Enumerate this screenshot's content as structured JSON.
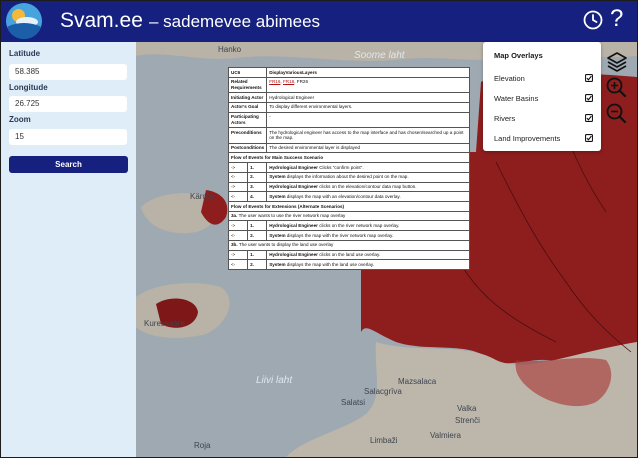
{
  "header": {
    "app_name": "Svam.ee",
    "subtitle": "– sademevee abimees",
    "help_symbol": "?"
  },
  "sidebar": {
    "latitude_label": "Latitude",
    "latitude_value": "58.385",
    "longitude_label": "Longitude",
    "longitude_value": "26.725",
    "zoom_label": "Zoom",
    "zoom_value": "15",
    "search_label": "Search"
  },
  "overlays": {
    "title": "Map Overlays",
    "items": [
      {
        "label": "Elevation",
        "checked": true
      },
      {
        "label": "Water Basins",
        "checked": true
      },
      {
        "label": "Rivers",
        "checked": true
      },
      {
        "label": "Land Improvements",
        "checked": true
      }
    ]
  },
  "map_labels": {
    "hanko": "Hanko",
    "soome_laht": "Soome laht",
    "kardla": "Kärdla",
    "kuressaare": "Kuressaare",
    "liivi_laht": "Liivi laht",
    "mazsalaca": "Mazsalaca",
    "salacgriva": "Salacgrīva",
    "salatsi": "Salatsi",
    "valka": "Valka",
    "strenci": "Strenči",
    "valmiera": "Valmiera",
    "limbazi": "Limbaži",
    "roja": "Roja"
  },
  "doc": {
    "uc_label": "UC6",
    "uc_value": "DisplayVariousLayers",
    "req_label": "Related Requirements",
    "req_1": "FR16",
    "req_2": "FR18",
    "req_3": "FR26",
    "actor_label": "Initiating Actor",
    "actor_value": "Hydrological Engineer",
    "goal_label": "Actor’s Goal",
    "goal_value": "To display different environmental layers.",
    "participants_label": "Participating Actors",
    "participants_value": "-",
    "pre_label": "Preconditions",
    "pre_value": "The hydrological engineer has access to the map interface and has chosen/searched up a point on the map.",
    "post_label": "Postconditions",
    "post_value": "The desired environmental layer is displayed",
    "main_flow_title": "Flow of Events for Main Success Scenario",
    "main_steps": [
      {
        "arrow": "->",
        "num": "1.",
        "actor": "Hydrological Engineer",
        "text": " Clicks \"confirm point\"."
      },
      {
        "arrow": "<-",
        "num": "2.",
        "actor": "System",
        "text": " displays the information about the desired point on the map."
      },
      {
        "arrow": "->",
        "num": "3.",
        "actor": "Hydrological Engineer",
        "text": " clicks on the elevation/contour data map button."
      },
      {
        "arrow": "<-",
        "num": "4.",
        "actor": "System",
        "text": " displays the map with an elevation/contour data overlay."
      }
    ],
    "ext_flow_title": "Flow of Events for Extensions (Alternate Scenarios)",
    "ext_3a_id": "3a.",
    "ext_3a_text": " The user wants to use the river network map overlay",
    "ext_3a_steps": [
      {
        "arrow": "->",
        "num": "1.",
        "actor": "Hydrological Engineer",
        "text": " clicks on the river network map overlay."
      },
      {
        "arrow": "<-",
        "num": "2.",
        "actor": "System",
        "text": " displays the map with the river network map overlay."
      }
    ],
    "ext_3b_id": "3b.",
    "ext_3b_text": " The user wants to display the land use overlay",
    "ext_3b_steps": [
      {
        "arrow": "->",
        "num": "1.",
        "actor": "Hydrological Engineer",
        "text": " clicks on the land use overlay."
      },
      {
        "arrow": "<-",
        "num": "2.",
        "actor": "System",
        "text": " displays the map with the land use overlay."
      }
    ]
  },
  "colors": {
    "header": "#15207f",
    "sidebar": "#deedf8",
    "overlay_red": "#8e1d1d",
    "sea": "#9fa9b2"
  }
}
